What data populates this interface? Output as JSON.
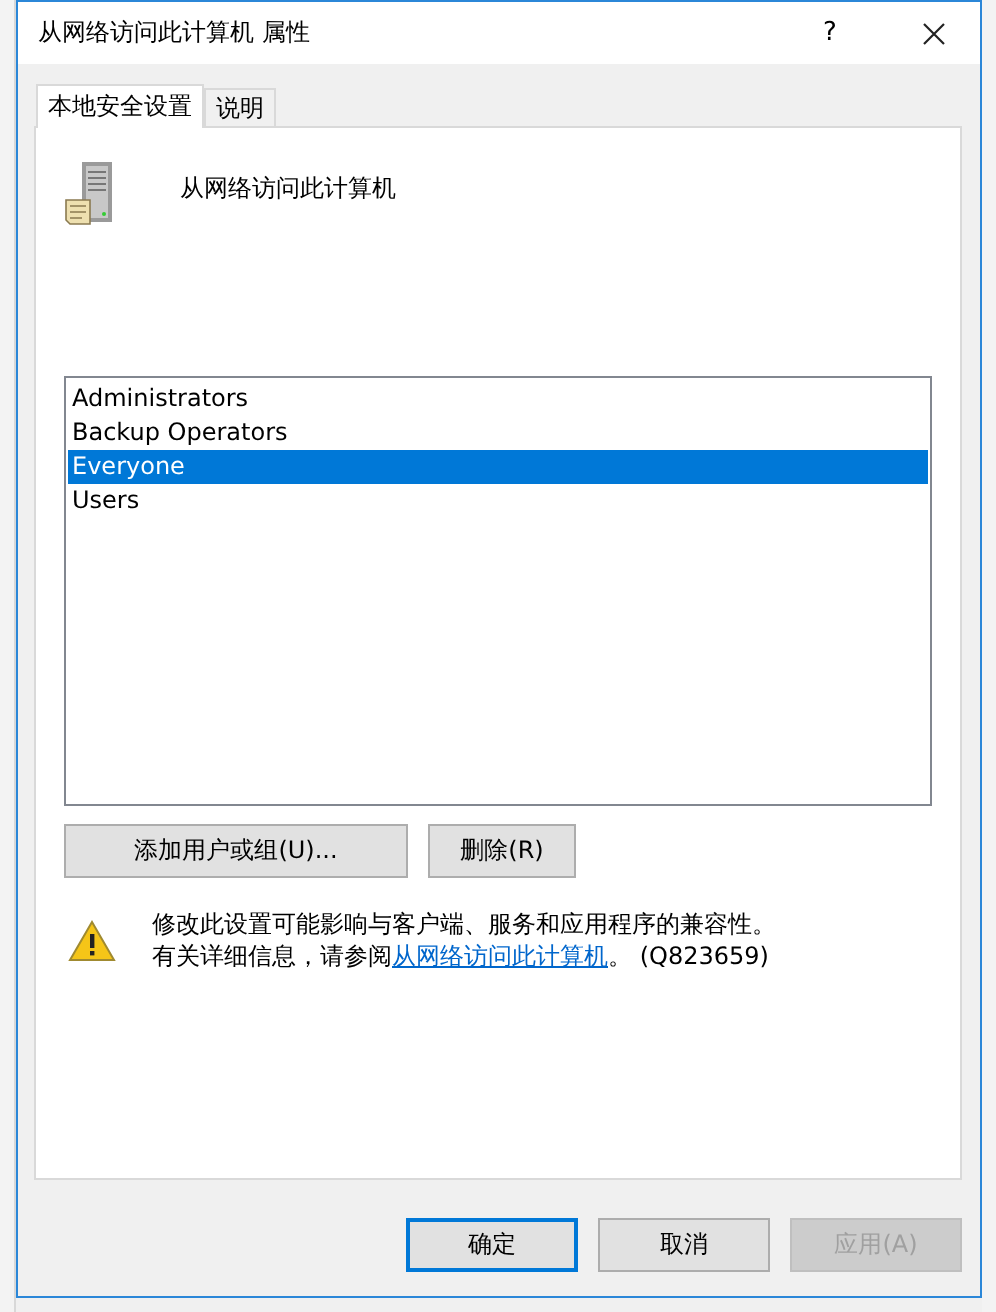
{
  "window": {
    "title": "从网络访问此计算机 属性",
    "help": "?"
  },
  "tabs": [
    {
      "label": "本地安全设置",
      "selected": true
    },
    {
      "label": "说明",
      "selected": false
    }
  ],
  "policy_name": "从网络访问此计算机",
  "members": [
    {
      "name": "Administrators",
      "selected": false
    },
    {
      "name": "Backup Operators",
      "selected": false
    },
    {
      "name": "Everyone",
      "selected": true
    },
    {
      "name": "Users",
      "selected": false
    }
  ],
  "member_buttons": [
    {
      "label": "添加用户或组(U)..."
    },
    {
      "label": "删除(R)"
    }
  ],
  "warning": {
    "line_1": "修改此设置可能影响与客户端、服务和应用程序的兼容性。",
    "line_2_before": "有关详细信息，请参阅",
    "link": "从网络访问此计算机",
    "line_2_after": "。 (Q823659)"
  },
  "footer_buttons": [
    {
      "label": "确定",
      "default": true,
      "disabled": false
    },
    {
      "label": "取消",
      "default": false,
      "disabled": false
    },
    {
      "label": "应用(A)",
      "default": false,
      "disabled": true
    }
  ]
}
